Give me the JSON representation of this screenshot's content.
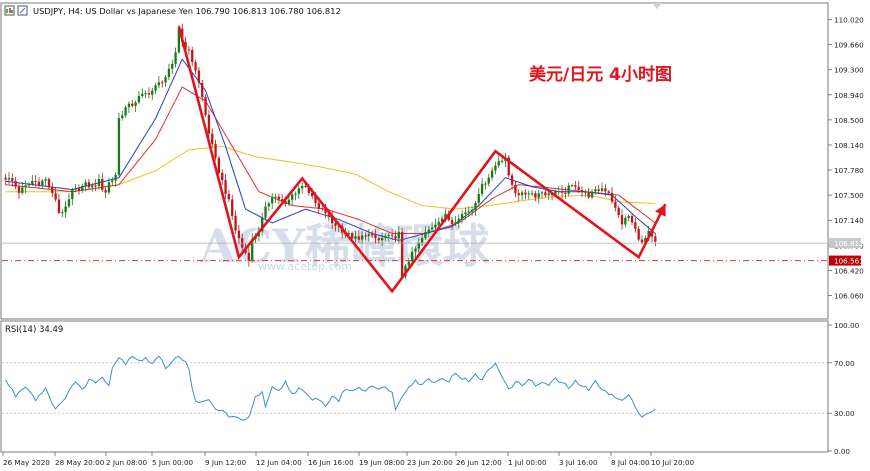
{
  "header": {
    "symbol_text": "USDJPY, H4:  US Dollar vs Japanese Yen  106.790 106.813 106.780 106.812"
  },
  "annotation": {
    "title": "美元/日元 4小时图",
    "watermark": "ACY稀峰環球",
    "watermark_url": "www.acetop.com"
  },
  "colors": {
    "bullish": "#1a7a1a",
    "bearish": "#c01818",
    "ma_fast": "#1f3fc8",
    "ma_mid": "#e03030",
    "ma_slow": "#f0c020",
    "rsi_line": "#3a8fd8",
    "arrow": "#e0141e",
    "support_line": "#d04040",
    "price_badge": "#c00000"
  },
  "chart_data": [
    {
      "type": "candlestick",
      "title": "USDJPY, H4: US Dollar vs Japanese Yen",
      "ohlc_header": {
        "open": 106.79,
        "high": 106.813,
        "low": 106.78,
        "close": 106.812
      },
      "yaxis_ticks": [
        "110.020",
        "109.660",
        "109.300",
        "108.940",
        "108.500",
        "108.140",
        "107.780",
        "107.500",
        "107.140",
        "106.780",
        "106.420",
        "106.060"
      ],
      "current_price_label": "106.812",
      "support_price_label": "106.561",
      "ylim": [
        105.78,
        110.22
      ],
      "support_level": 106.561,
      "current_price": 106.812,
      "xaxis_ticks": [
        "26 May 2020",
        "28 May 20:00",
        "2 Jun 08:00",
        "5 Jun 00:00",
        "9 Jun 12:00",
        "12 Jun 04:00",
        "16 Jun 16:00",
        "19 Jun 08:00",
        "23 Jun 20:00",
        "26 Jun 12:00",
        "1 Jul 00:00",
        "3 Jul 16:00",
        "8 Jul 04:00",
        "10 Jul 20:00"
      ],
      "close_path": [
        [
          0,
          107.75
        ],
        [
          2,
          107.7
        ],
        [
          4,
          107.55
        ],
        [
          6,
          107.62
        ],
        [
          8,
          107.7
        ],
        [
          10,
          107.68
        ],
        [
          12,
          107.72
        ],
        [
          13,
          107.62
        ],
        [
          14,
          107.5
        ],
        [
          15,
          107.45
        ],
        [
          16,
          107.25
        ],
        [
          18,
          107.3
        ],
        [
          20,
          107.55
        ],
        [
          22,
          107.6
        ],
        [
          24,
          107.65
        ],
        [
          26,
          107.62
        ],
        [
          28,
          107.7
        ],
        [
          29,
          107.6
        ],
        [
          30,
          107.55
        ],
        [
          31,
          107.68
        ],
        [
          32,
          107.72
        ],
        [
          33,
          107.8
        ],
        [
          34,
          108.6
        ],
        [
          36,
          108.75
        ],
        [
          38,
          108.8
        ],
        [
          40,
          108.9
        ],
        [
          42,
          108.95
        ],
        [
          44,
          109.0
        ],
        [
          46,
          109.1
        ],
        [
          48,
          109.2
        ],
        [
          50,
          109.35
        ],
        [
          51,
          109.55
        ],
        [
          52,
          109.9
        ],
        [
          53,
          109.7
        ],
        [
          55,
          109.55
        ],
        [
          57,
          109.3
        ],
        [
          59,
          108.9
        ],
        [
          61,
          108.4
        ],
        [
          63,
          108.0
        ],
        [
          65,
          107.7
        ],
        [
          67,
          107.4
        ],
        [
          69,
          107.0
        ],
        [
          71,
          106.75
        ],
        [
          73,
          106.6
        ],
        [
          74,
          106.85
        ],
        [
          76,
          107.0
        ],
        [
          78,
          107.3
        ],
        [
          80,
          107.5
        ],
        [
          82,
          107.45
        ],
        [
          84,
          107.35
        ],
        [
          86,
          107.5
        ],
        [
          88,
          107.6
        ],
        [
          90,
          107.65
        ],
        [
          92,
          107.45
        ],
        [
          94,
          107.3
        ],
        [
          96,
          107.25
        ],
        [
          98,
          107.1
        ],
        [
          100,
          107.05
        ],
        [
          102,
          106.95
        ],
        [
          104,
          106.9
        ],
        [
          106,
          106.85
        ],
        [
          108,
          106.95
        ],
        [
          110,
          106.9
        ],
        [
          112,
          106.85
        ],
        [
          114,
          106.9
        ],
        [
          116,
          106.88
        ],
        [
          118,
          106.95
        ],
        [
          119,
          106.3
        ],
        [
          120,
          106.5
        ],
        [
          122,
          106.65
        ],
        [
          124,
          106.8
        ],
        [
          126,
          106.95
        ],
        [
          128,
          107.05
        ],
        [
          130,
          107.15
        ],
        [
          132,
          107.2
        ],
        [
          134,
          107.1
        ],
        [
          136,
          107.2
        ],
        [
          138,
          107.25
        ],
        [
          140,
          107.3
        ],
        [
          142,
          107.55
        ],
        [
          144,
          107.7
        ],
        [
          146,
          107.85
        ],
        [
          148,
          108.0
        ],
        [
          150,
          108.05
        ],
        [
          151,
          107.75
        ],
        [
          153,
          107.55
        ],
        [
          155,
          107.5
        ],
        [
          157,
          107.55
        ],
        [
          159,
          107.5
        ],
        [
          161,
          107.55
        ],
        [
          163,
          107.5
        ],
        [
          165,
          107.55
        ],
        [
          167,
          107.5
        ],
        [
          169,
          107.6
        ],
        [
          171,
          107.65
        ],
        [
          173,
          107.55
        ],
        [
          175,
          107.5
        ],
        [
          177,
          107.55
        ],
        [
          179,
          107.6
        ],
        [
          181,
          107.55
        ],
        [
          183,
          107.3
        ],
        [
          185,
          107.1
        ],
        [
          187,
          107.2
        ],
        [
          189,
          107.0
        ],
        [
          191,
          106.8
        ],
        [
          193,
          106.95
        ],
        [
          195,
          106.81
        ]
      ],
      "ma_fast": [
        [
          0,
          107.7
        ],
        [
          20,
          107.58
        ],
        [
          34,
          107.75
        ],
        [
          45,
          108.6
        ],
        [
          53,
          109.45
        ],
        [
          60,
          109.0
        ],
        [
          66,
          108.2
        ],
        [
          72,
          107.3
        ],
        [
          80,
          107.1
        ],
        [
          90,
          107.3
        ],
        [
          100,
          107.15
        ],
        [
          110,
          106.95
        ],
        [
          118,
          106.85
        ],
        [
          126,
          106.95
        ],
        [
          134,
          107.05
        ],
        [
          142,
          107.35
        ],
        [
          150,
          107.75
        ],
        [
          158,
          107.62
        ],
        [
          166,
          107.55
        ],
        [
          174,
          107.55
        ],
        [
          182,
          107.5
        ],
        [
          190,
          107.15
        ],
        [
          195,
          106.95
        ]
      ],
      "ma_mid": [
        [
          0,
          107.65
        ],
        [
          20,
          107.55
        ],
        [
          34,
          107.65
        ],
        [
          45,
          108.3
        ],
        [
          53,
          109.05
        ],
        [
          60,
          108.85
        ],
        [
          68,
          108.2
        ],
        [
          76,
          107.55
        ],
        [
          86,
          107.35
        ],
        [
          96,
          107.3
        ],
        [
          106,
          107.15
        ],
        [
          116,
          106.95
        ],
        [
          126,
          106.95
        ],
        [
          136,
          107.1
        ],
        [
          146,
          107.45
        ],
        [
          154,
          107.65
        ],
        [
          164,
          107.6
        ],
        [
          174,
          107.55
        ],
        [
          184,
          107.5
        ],
        [
          195,
          107.1
        ]
      ],
      "ma_slow": [
        [
          0,
          107.55
        ],
        [
          20,
          107.55
        ],
        [
          34,
          107.65
        ],
        [
          45,
          107.85
        ],
        [
          55,
          108.15
        ],
        [
          65,
          108.2
        ],
        [
          75,
          108.05
        ],
        [
          85,
          107.98
        ],
        [
          95,
          107.9
        ],
        [
          105,
          107.8
        ],
        [
          115,
          107.55
        ],
        [
          125,
          107.35
        ],
        [
          135,
          107.3
        ],
        [
          145,
          107.35
        ],
        [
          155,
          107.42
        ],
        [
          165,
          107.48
        ],
        [
          175,
          107.5
        ],
        [
          185,
          107.4
        ],
        [
          195,
          107.38
        ]
      ],
      "arrow_path": [
        [
          52,
          109.92
        ],
        [
          70,
          106.61
        ],
        [
          89,
          107.74
        ],
        [
          116,
          106.12
        ],
        [
          147,
          108.13
        ],
        [
          190,
          106.61
        ],
        [
          198,
          107.37
        ]
      ]
    },
    {
      "type": "line",
      "title": "RSI(14) 34.49",
      "series_name": "RSI(14)",
      "last_value": 34.49,
      "ylim": [
        0,
        100
      ],
      "yaxis_ticks": [
        "100.00",
        "70.00",
        "30.00",
        "0.00"
      ],
      "levels": [
        70,
        30
      ],
      "values": [
        [
          0,
          56
        ],
        [
          3,
          44
        ],
        [
          6,
          52
        ],
        [
          9,
          41
        ],
        [
          12,
          50
        ],
        [
          15,
          33
        ],
        [
          17,
          38
        ],
        [
          19,
          49
        ],
        [
          21,
          55
        ],
        [
          23,
          48
        ],
        [
          25,
          57
        ],
        [
          27,
          54
        ],
        [
          29,
          60
        ],
        [
          31,
          52
        ],
        [
          32,
          67
        ],
        [
          34,
          74
        ],
        [
          36,
          70
        ],
        [
          38,
          76
        ],
        [
          40,
          72
        ],
        [
          42,
          73
        ],
        [
          44,
          70
        ],
        [
          46,
          75
        ],
        [
          48,
          66
        ],
        [
          50,
          72
        ],
        [
          52,
          76
        ],
        [
          54,
          70
        ],
        [
          55,
          64
        ],
        [
          56,
          49
        ],
        [
          57,
          41
        ],
        [
          59,
          38
        ],
        [
          61,
          40
        ],
        [
          63,
          33
        ],
        [
          65,
          32
        ],
        [
          67,
          28
        ],
        [
          69,
          26
        ],
        [
          71,
          24
        ],
        [
          73,
          28
        ],
        [
          75,
          42
        ],
        [
          77,
          47
        ],
        [
          78,
          34
        ],
        [
          80,
          50
        ],
        [
          82,
          47
        ],
        [
          84,
          55
        ],
        [
          86,
          45
        ],
        [
          88,
          50
        ],
        [
          90,
          45
        ],
        [
          92,
          40
        ],
        [
          94,
          42
        ],
        [
          96,
          35
        ],
        [
          98,
          44
        ],
        [
          100,
          40
        ],
        [
          102,
          50
        ],
        [
          104,
          47
        ],
        [
          106,
          51
        ],
        [
          108,
          48
        ],
        [
          110,
          53
        ],
        [
          112,
          49
        ],
        [
          114,
          50
        ],
        [
          116,
          48
        ],
        [
          117,
          32
        ],
        [
          119,
          44
        ],
        [
          121,
          52
        ],
        [
          123,
          56
        ],
        [
          125,
          52
        ],
        [
          127,
          58
        ],
        [
          129,
          54
        ],
        [
          131,
          59
        ],
        [
          133,
          55
        ],
        [
          135,
          62
        ],
        [
          137,
          58
        ],
        [
          139,
          55
        ],
        [
          141,
          60
        ],
        [
          143,
          57
        ],
        [
          145,
          64
        ],
        [
          147,
          70
        ],
        [
          149,
          60
        ],
        [
          151,
          48
        ],
        [
          153,
          55
        ],
        [
          155,
          52
        ],
        [
          157,
          58
        ],
        [
          159,
          51
        ],
        [
          161,
          55
        ],
        [
          163,
          52
        ],
        [
          165,
          57
        ],
        [
          167,
          54
        ],
        [
          169,
          50
        ],
        [
          171,
          55
        ],
        [
          173,
          52
        ],
        [
          175,
          48
        ],
        [
          177,
          55
        ],
        [
          179,
          50
        ],
        [
          181,
          46
        ],
        [
          183,
          42
        ],
        [
          185,
          40
        ],
        [
          187,
          44
        ],
        [
          189,
          35
        ],
        [
          191,
          28
        ],
        [
          193,
          30
        ],
        [
          195,
          34
        ]
      ]
    }
  ]
}
